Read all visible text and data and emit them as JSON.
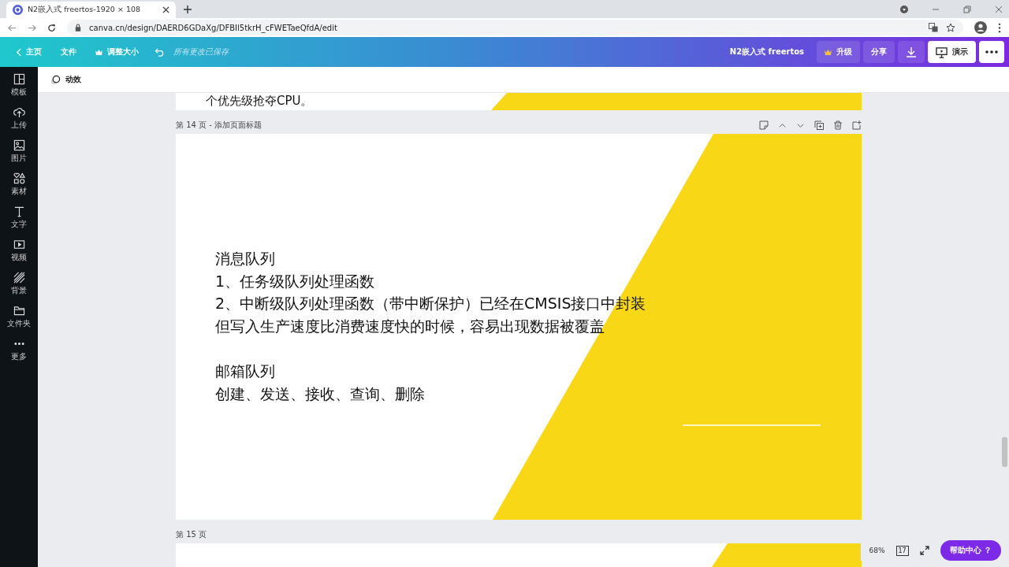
{
  "browser": {
    "tabs": [
      {
        "title": "N2嵌入式 freertos-1920 × 108",
        "selected": true
      }
    ],
    "url": "canva.cn/design/DAERD6GDaXg/DFBIl5tkrH_cFWETaeQfdA/edit"
  },
  "toolbar": {
    "left": [
      {
        "kind": "back",
        "label": "主页"
      },
      {
        "kind": "plain",
        "label": "文件"
      },
      {
        "kind": "crown",
        "label": "调整大小"
      }
    ],
    "save_status": "所有更改已保存",
    "design_title": "N2嵌入式 freertos",
    "right": [
      {
        "kind": "upgrade",
        "label": "升级"
      },
      {
        "kind": "share",
        "label": "分享"
      },
      {
        "kind": "download"
      },
      {
        "kind": "present",
        "label": "演示"
      },
      {
        "kind": "more"
      }
    ]
  },
  "sidebar": {
    "items": [
      {
        "kind": "templates",
        "label": "模板"
      },
      {
        "kind": "upload",
        "label": "上传"
      },
      {
        "kind": "photos",
        "label": "图片"
      },
      {
        "kind": "elements",
        "label": "素材"
      },
      {
        "kind": "text",
        "label": "文字"
      },
      {
        "kind": "video",
        "label": "视频"
      },
      {
        "kind": "background",
        "label": "背景"
      },
      {
        "kind": "folder",
        "label": "文件夹"
      },
      {
        "kind": "more",
        "label": "更多"
      }
    ]
  },
  "context_bar": {
    "label": "动效"
  },
  "pages": [
    {
      "kind": "partial_top",
      "text": "个优先级抢夺CPU。"
    },
    {
      "kind": "full",
      "label": "第 14 页 - 添加页面标题",
      "paragraphs": [
        [
          "消息队列",
          "1、任务级队列处理函数",
          "2、中断级队列处理函数（带中断保护）已经在CMSIS接口中封装",
          "但写入生产速度比消费速度快的时候，容易出现数据被覆盖"
        ],
        [
          "邮箱队列",
          "创建、发送、接收、查询、删除"
        ]
      ]
    },
    {
      "kind": "partial_bottom",
      "label": "第 15 页"
    }
  ],
  "footer": {
    "zoom": "68%",
    "page_count": "17",
    "help": "帮助中心 ？"
  }
}
